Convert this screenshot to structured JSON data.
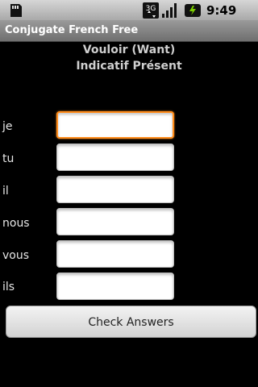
{
  "status_bar": {
    "time": "9:49 PM",
    "network": "3G",
    "icons": [
      "sd-card-icon",
      "3g-data-icon",
      "signal-icon",
      "battery-icon"
    ]
  },
  "app": {
    "title": "Conjugate French Free"
  },
  "quiz": {
    "verb": "Vouloir (Want)",
    "tense": "Indicatif Présent"
  },
  "rows": [
    {
      "pronoun": "je",
      "value": "",
      "focused": true
    },
    {
      "pronoun": "tu",
      "value": ""
    },
    {
      "pronoun": "il",
      "value": ""
    },
    {
      "pronoun": "nous",
      "value": ""
    },
    {
      "pronoun": "vous",
      "value": ""
    },
    {
      "pronoun": "ils",
      "value": ""
    }
  ],
  "actions": {
    "check_label": "Check Answers"
  },
  "colors": {
    "focus": "#ff8c1a",
    "background": "#000000"
  }
}
